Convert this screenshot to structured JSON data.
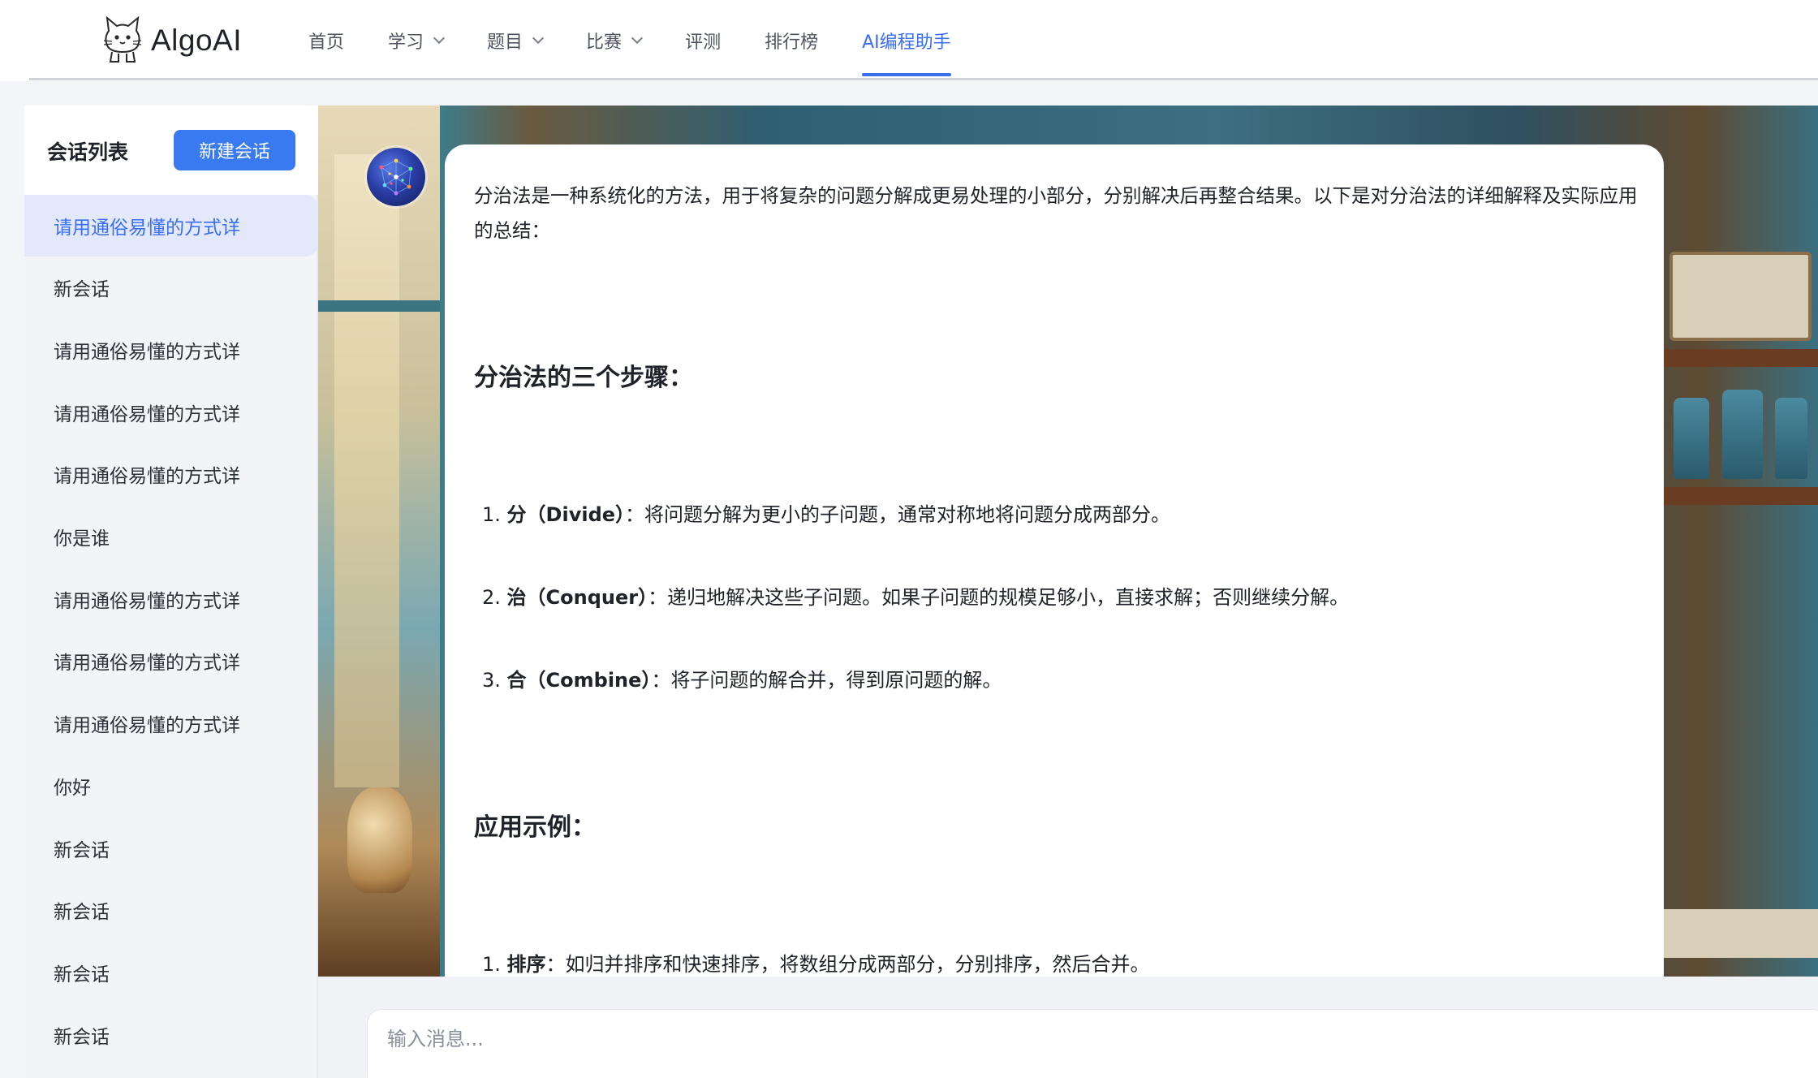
{
  "app": {
    "brand": "AlgoAI",
    "logo_icon": "cat-logo-icon",
    "accent_color": "#3a6ff0"
  },
  "nav": {
    "items": [
      {
        "label": "首页",
        "has_dropdown": false,
        "active": false
      },
      {
        "label": "学习",
        "has_dropdown": true,
        "active": false
      },
      {
        "label": "题目",
        "has_dropdown": true,
        "active": false
      },
      {
        "label": "比赛",
        "has_dropdown": true,
        "active": false
      },
      {
        "label": "评测",
        "has_dropdown": false,
        "active": false
      },
      {
        "label": "排行榜",
        "has_dropdown": false,
        "active": false
      },
      {
        "label": "AI编程助手",
        "has_dropdown": false,
        "active": true
      }
    ]
  },
  "sidebar": {
    "title": "会话列表",
    "new_button": "新建会话",
    "conversations": [
      {
        "label": "请用通俗易懂的方式详",
        "active": true
      },
      {
        "label": "新会话",
        "active": false
      },
      {
        "label": "请用通俗易懂的方式详",
        "active": false
      },
      {
        "label": "请用通俗易懂的方式详",
        "active": false
      },
      {
        "label": "请用通俗易懂的方式详",
        "active": false
      },
      {
        "label": "你是谁",
        "active": false
      },
      {
        "label": "请用通俗易懂的方式详",
        "active": false
      },
      {
        "label": "请用通俗易懂的方式详",
        "active": false
      },
      {
        "label": "请用通俗易懂的方式详",
        "active": false
      },
      {
        "label": "你好",
        "active": false
      },
      {
        "label": "新会话",
        "active": false
      },
      {
        "label": "新会话",
        "active": false
      },
      {
        "label": "新会话",
        "active": false
      },
      {
        "label": "新会话",
        "active": false
      }
    ]
  },
  "chat": {
    "message": {
      "intro": "分治法是一种系统化的方法，用于将复杂的问题分解成更易处理的小部分，分别解决后再整合结果。以下是对分治法的详细解释及实际应用的总结：",
      "section1_title": "分治法的三个步骤：",
      "steps": [
        {
          "num": "1.",
          "term": "分（Divide）",
          "desc": "：将问题分解为更小的子问题，通常对称地将问题分成两部分。"
        },
        {
          "num": "2.",
          "term": "治（Conquer）",
          "desc": "：递归地解决这些子问题。如果子问题的规模足够小，直接求解；否则继续分解。"
        },
        {
          "num": "3.",
          "term": "合（Combine）",
          "desc": "：将子问题的解合并，得到原问题的解。"
        }
      ],
      "section2_title": "应用示例：",
      "examples": [
        {
          "num": "1.",
          "term": "排序",
          "desc": "：如归并排序和快速排序，将数组分成两部分，分别排序，然后合并。"
        }
      ]
    },
    "input_placeholder": "输入消息..."
  }
}
